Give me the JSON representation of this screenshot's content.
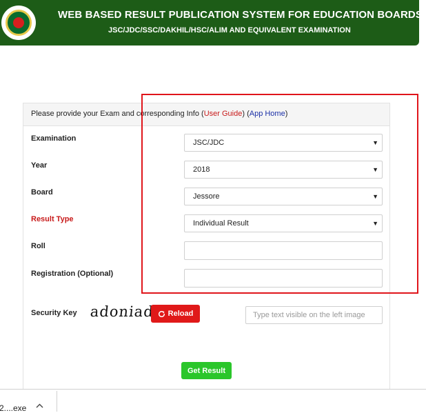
{
  "header": {
    "title": "WEB BASED RESULT PUBLICATION SYSTEM FOR EDUCATION BOARDS",
    "subtitle": "JSC/JDC/SSC/DAKHIL/HSC/ALIM AND EQUIVALENT EXAMINATION",
    "logo_icon": "government-seal-icon"
  },
  "panel": {
    "intro": "Please provide your Exam and corresponding Info (",
    "user_guide": "User Guide",
    "between": ") (",
    "app_home": "App Home",
    "close": ")"
  },
  "form": {
    "examination": {
      "label": "Examination",
      "value": "JSC/JDC"
    },
    "year": {
      "label": "Year",
      "value": "2018"
    },
    "board": {
      "label": "Board",
      "value": "Jessore"
    },
    "result_type": {
      "label": "Result Type",
      "value": "Individual Result"
    },
    "roll": {
      "label": "Roll",
      "value": ""
    },
    "registration": {
      "label": "Registration (Optional)",
      "value": ""
    },
    "security_key": {
      "label": "Security Key",
      "captcha_text": "adoniad",
      "reload_label": "Reload",
      "reload_icon": "refresh-icon",
      "placeholder": "Type text visible on the left image"
    },
    "submit_label": "Get Result",
    "caret_icon": "▼"
  },
  "download_bar": {
    "file_name": "2....exe",
    "chevron_icon": "chevron-up-icon"
  },
  "colors": {
    "header_bg": "#1d5c17",
    "required_label": "#c81a1a",
    "reload_button": "#e01919",
    "submit_button": "#2ac62a",
    "annotation_box": "#e0141a"
  }
}
